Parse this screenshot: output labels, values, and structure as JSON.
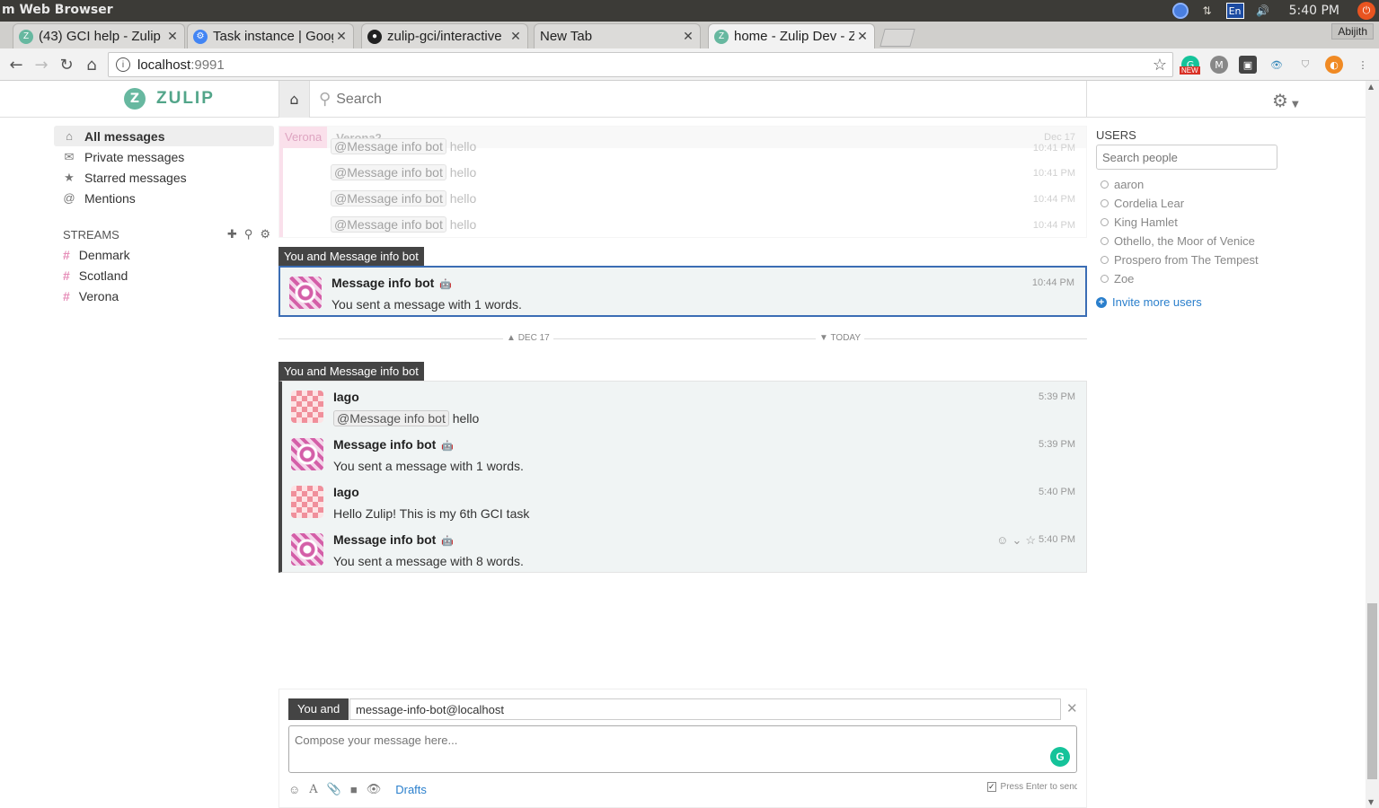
{
  "os": {
    "title": "m Web Browser",
    "clock": "5:40 PM",
    "lang": "En"
  },
  "browser": {
    "tabs": [
      {
        "label": "(43) GCI help - Zulip",
        "favicon_color": "#67b8a0"
      },
      {
        "label": "Task instance | Google",
        "favicon_color": "#4285f4"
      },
      {
        "label": "zulip-gci/interactive",
        "favicon_color": "#222222"
      },
      {
        "label": "New Tab",
        "favicon_color": ""
      },
      {
        "label": "home - Zulip Dev - Zulip",
        "favicon_color": "#67b8a0"
      }
    ],
    "profile": "Abijith",
    "url_host": "localhost",
    "url_port": ":9991",
    "ext_badge": "NEW"
  },
  "app": {
    "logo": "ZULIP",
    "search_placeholder": "Search"
  },
  "left": {
    "nav": [
      {
        "label": "All messages",
        "icon": "home-icon"
      },
      {
        "label": "Private messages",
        "icon": "envelope-icon"
      },
      {
        "label": "Starred messages",
        "icon": "star-icon"
      },
      {
        "label": "Mentions",
        "icon": "at-icon"
      }
    ],
    "streams_header": "STREAMS",
    "streams": [
      "Denmark",
      "Scotland",
      "Verona"
    ]
  },
  "faded": {
    "stream": "Verona",
    "topic": "Verona2",
    "date": "Dec 17",
    "rows": [
      {
        "mention": "@Message info bot",
        "text": "hello",
        "time": "10:41 PM"
      },
      {
        "mention": "@Message info bot",
        "text": "hello",
        "time": "10:41 PM"
      },
      {
        "mention": "@Message info bot",
        "text": "hello",
        "time": "10:44 PM"
      },
      {
        "mention": "@Message info bot",
        "text": "hello",
        "time": "10:44 PM"
      }
    ]
  },
  "group1": {
    "recipient": "You and Message info bot",
    "msg": {
      "sender": "Message info bot",
      "body": "You sent a message with 1 words.",
      "time": "10:44 PM"
    }
  },
  "date_sep": {
    "left": "DEC 17",
    "right": "TODAY"
  },
  "group2": {
    "recipient": "You and Message info bot",
    "messages": [
      {
        "sender": "Iago",
        "mention": "@Message info bot",
        "body": "hello",
        "time": "5:39 PM"
      },
      {
        "sender": "Message info bot",
        "body": "You sent a message with 1 words.",
        "time": "5:39 PM"
      },
      {
        "sender": "Iago",
        "body": "Hello Zulip! This is my 6th GCI task",
        "time": "5:40 PM"
      },
      {
        "sender": "Message info bot",
        "body": "You sent a message with 8 words.",
        "time": "5:40 PM"
      }
    ]
  },
  "users": {
    "header": "USERS",
    "search_placeholder": "Search people",
    "list": [
      "aaron",
      "Cordelia Lear",
      "King Hamlet",
      "Othello, the Moor of Venice",
      "Prospero from The Tempest",
      "Zoe"
    ],
    "invite": "Invite more users"
  },
  "compose": {
    "you_and": "You and",
    "recipient": "message-info-bot@localhost",
    "placeholder": "Compose your message here...",
    "drafts": "Drafts",
    "enter_label": "Press Enter to send"
  }
}
